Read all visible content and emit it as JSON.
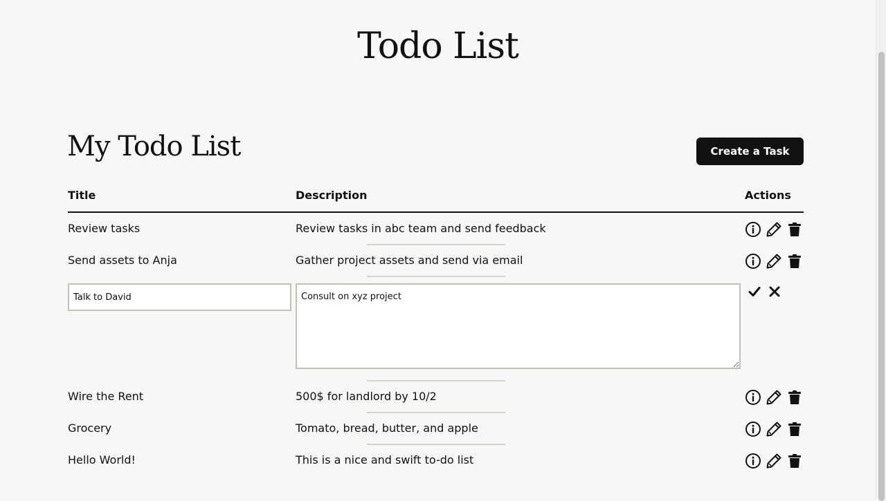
{
  "app_title": "Todo List",
  "list_heading": "My Todo List",
  "create_button_label": "Create a Task",
  "table": {
    "columns": [
      "Title",
      "Description",
      "Actions"
    ]
  },
  "tasks_before_edit": [
    {
      "title": "Review tasks",
      "description": "Review tasks in abc team and send feedback"
    },
    {
      "title": "Send assets to Anja",
      "description": "Gather project assets and send via email"
    }
  ],
  "editing_task": {
    "title": "Talk to David",
    "description": "Consult on xyz project"
  },
  "tasks_after_edit": [
    {
      "title": "Wire the Rent",
      "description": "500$ for landlord by 10/2"
    },
    {
      "title": "Grocery",
      "description": "Tomato, bread, butter, and apple"
    },
    {
      "title": "Hello World!",
      "description": "This is a nice and swift to-do list"
    }
  ],
  "icons": {
    "info": "info-circle-icon",
    "edit": "pencil-icon",
    "delete": "trash-icon",
    "confirm": "checkmark-icon",
    "cancel": "x-icon"
  },
  "colors": {
    "background": "#f7f7f7",
    "button": "#121212",
    "divider": "#d6d2c8",
    "input_border": "#c5c0b5"
  }
}
